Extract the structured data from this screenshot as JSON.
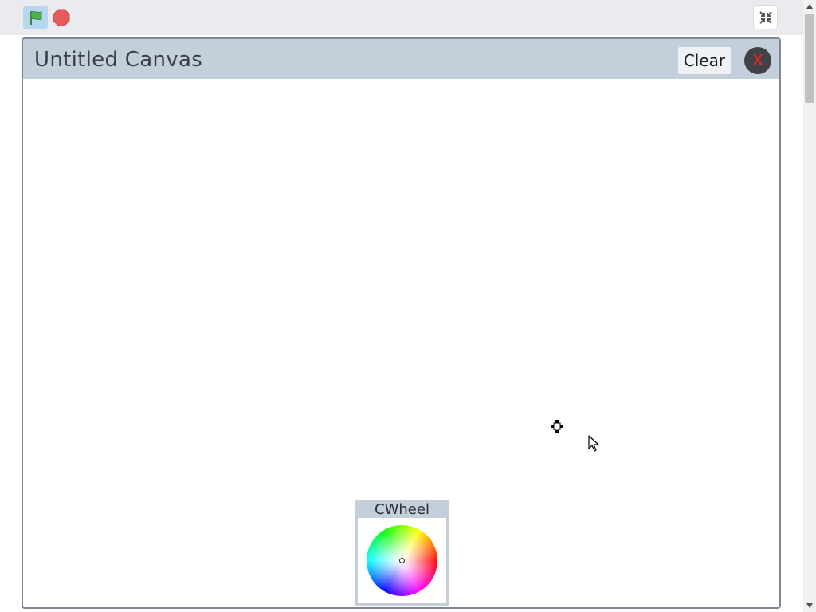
{
  "toolbar": {
    "green_flag_icon": "green-flag-icon",
    "stop_icon": "stop-icon",
    "fullscreen_icon": "exit-fullscreen-icon",
    "colors": {
      "flag_green": "#4caf50",
      "stop_red": "#e65a5a"
    }
  },
  "canvas_window": {
    "title": "Untitled Canvas",
    "clear_label": "Clear",
    "close_label": "X",
    "colors": {
      "titlebar": "#c3cfda",
      "close_bg": "#3f4247",
      "close_x": "#d42a2a"
    }
  },
  "color_wheel": {
    "title": "CWheel"
  }
}
